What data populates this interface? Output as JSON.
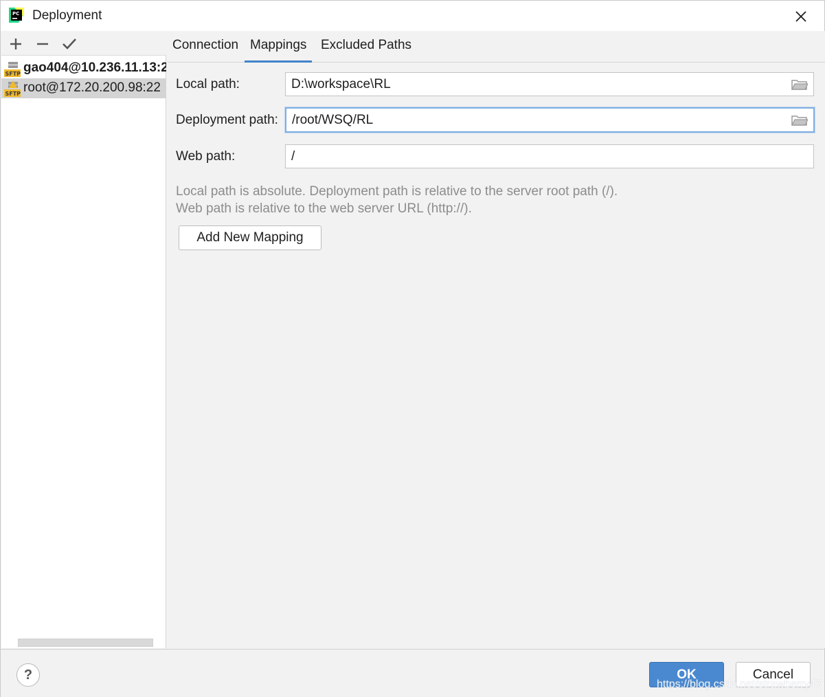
{
  "window": {
    "title": "Deployment"
  },
  "icons": {
    "app": "pycharm-app-icon",
    "close": "close-icon",
    "add": "plus-icon",
    "remove": "minus-icon",
    "default": "checkmark-icon",
    "server": "sftp-server-icon",
    "browse": "folder-icon",
    "help": "help-icon"
  },
  "sidebar": {
    "servers": [
      {
        "label": "gao404@10.236.11.13:2",
        "bold": true,
        "selected": false,
        "icon_badge": "SFTP"
      },
      {
        "label": "root@172.20.200.98:22",
        "bold": false,
        "selected": true,
        "icon_badge": "SFTP"
      }
    ]
  },
  "tabs": [
    {
      "label": "Connection",
      "active": false
    },
    {
      "label": "Mappings",
      "active": true
    },
    {
      "label": "Excluded Paths",
      "active": false
    }
  ],
  "mappings": {
    "local_path_label": "Local path:",
    "local_path_value": "D:\\workspace\\RL",
    "deployment_path_label": "Deployment path:",
    "deployment_path_value": "/root/WSQ/RL",
    "web_path_label": "Web path:",
    "web_path_value": "/",
    "hint_line1": "Local path is absolute. Deployment path is relative to the server root path (/).",
    "hint_line2": "Web path is relative to the web server URL (http://).",
    "add_button": "Add New Mapping"
  },
  "footer": {
    "help_label": "?",
    "ok_label": "OK",
    "cancel_label": "Cancel",
    "watermark": "https://blog.csdn.net/strawberry47"
  },
  "colors": {
    "accent": "#4083c9",
    "ok_button": "#4a89d0",
    "selection": "#d4d4d4",
    "focus_border": "#80aee0",
    "hint_text": "#8c8c8c"
  }
}
